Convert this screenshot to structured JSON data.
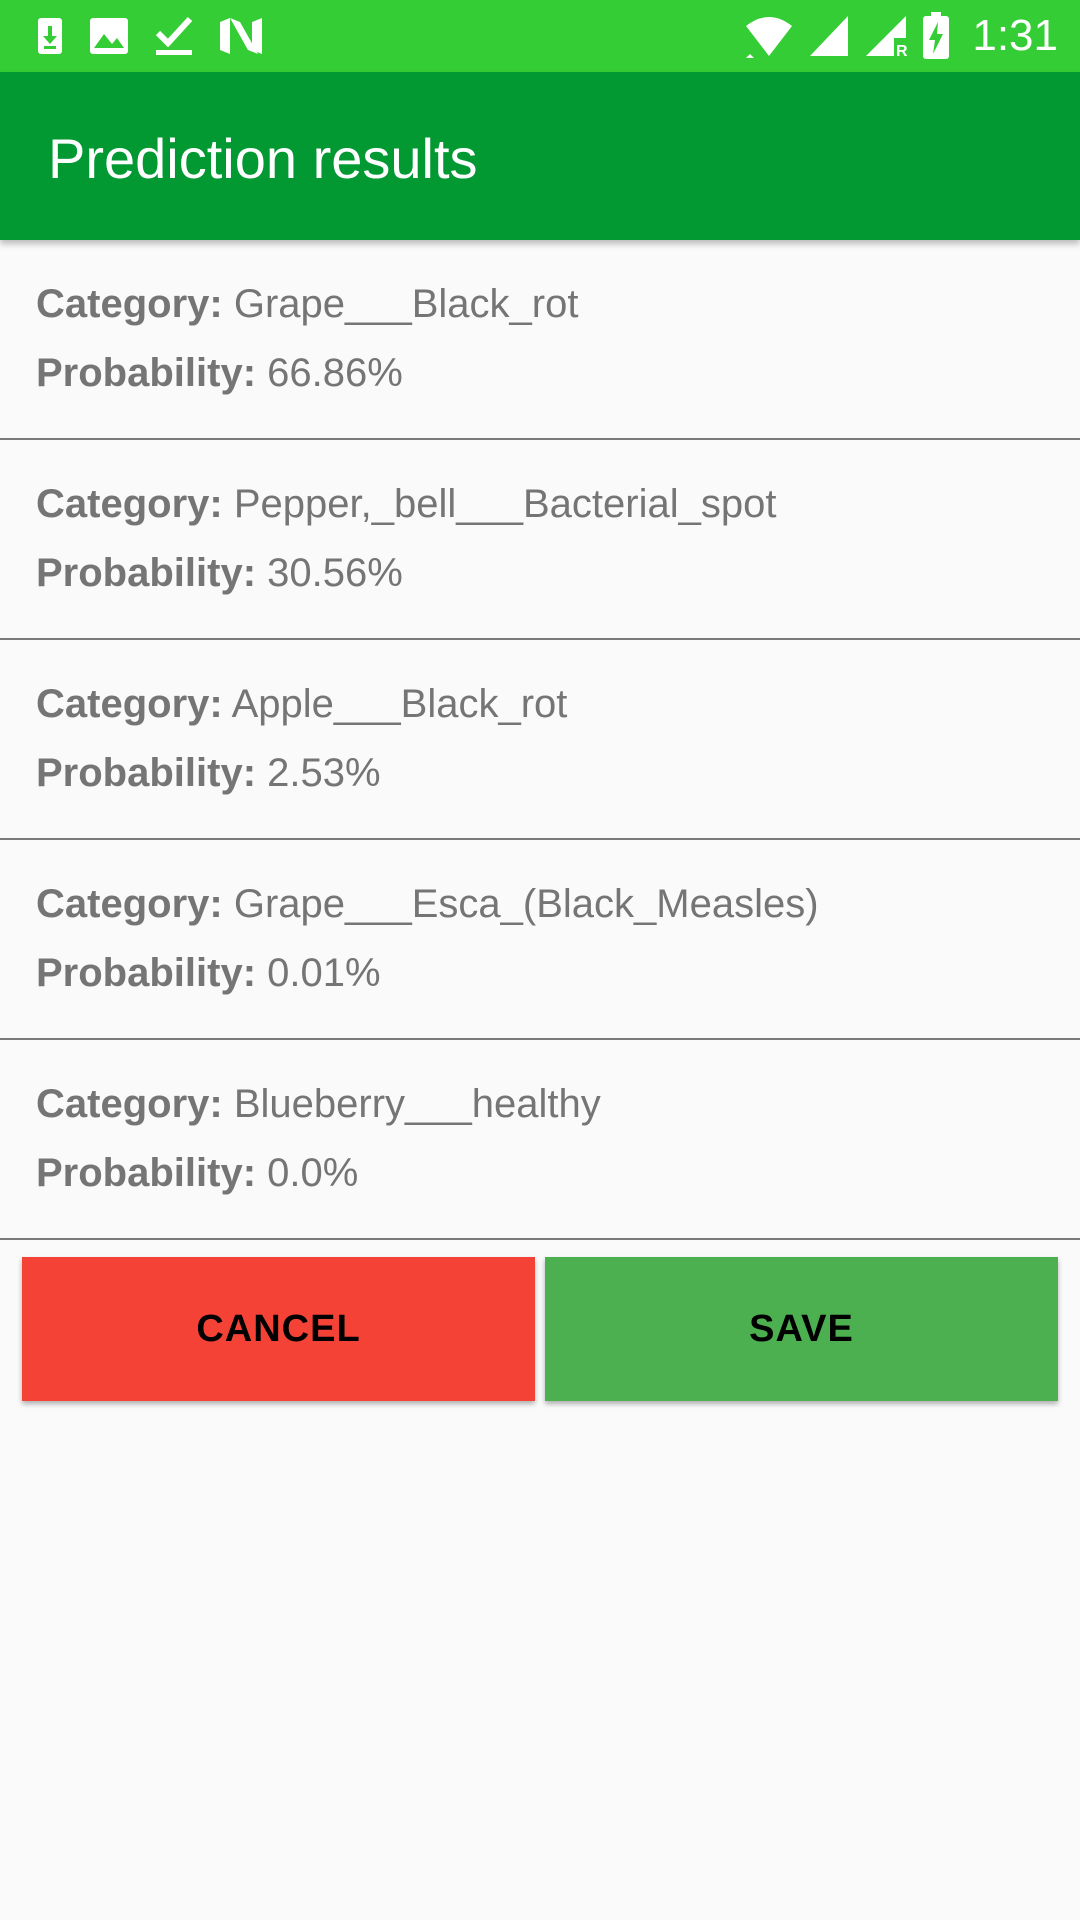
{
  "status_bar": {
    "time": "1:31",
    "left_icons": [
      "download-icon",
      "image-icon",
      "checkmark-icon",
      "n-logo-icon"
    ],
    "right_icons": [
      "wifi-icon",
      "cell-signal-icon",
      "cell-signal-roaming-icon",
      "battery-charging-icon"
    ],
    "roaming_label": "R"
  },
  "app_bar": {
    "title": "Prediction results"
  },
  "labels": {
    "category": "Category:",
    "probability": "Probability:"
  },
  "results": [
    {
      "category": "Grape___Black_rot",
      "probability": "66.86%"
    },
    {
      "category": "Pepper,_bell___Bacterial_spot",
      "probability": "30.56%"
    },
    {
      "category": "Apple___Black_rot",
      "probability": "2.53%"
    },
    {
      "category": "Grape___Esca_(Black_Measles)",
      "probability": "0.01%"
    },
    {
      "category": "Blueberry___healthy",
      "probability": "0.0%"
    }
  ],
  "buttons": {
    "cancel_label": "CANCEL",
    "save_label": "SAVE"
  },
  "colors": {
    "status_bar": "#35cd35",
    "app_bar": "#029933",
    "cancel_button": "#f44336",
    "save_button": "#4caf50",
    "text_gray": "#757575"
  }
}
